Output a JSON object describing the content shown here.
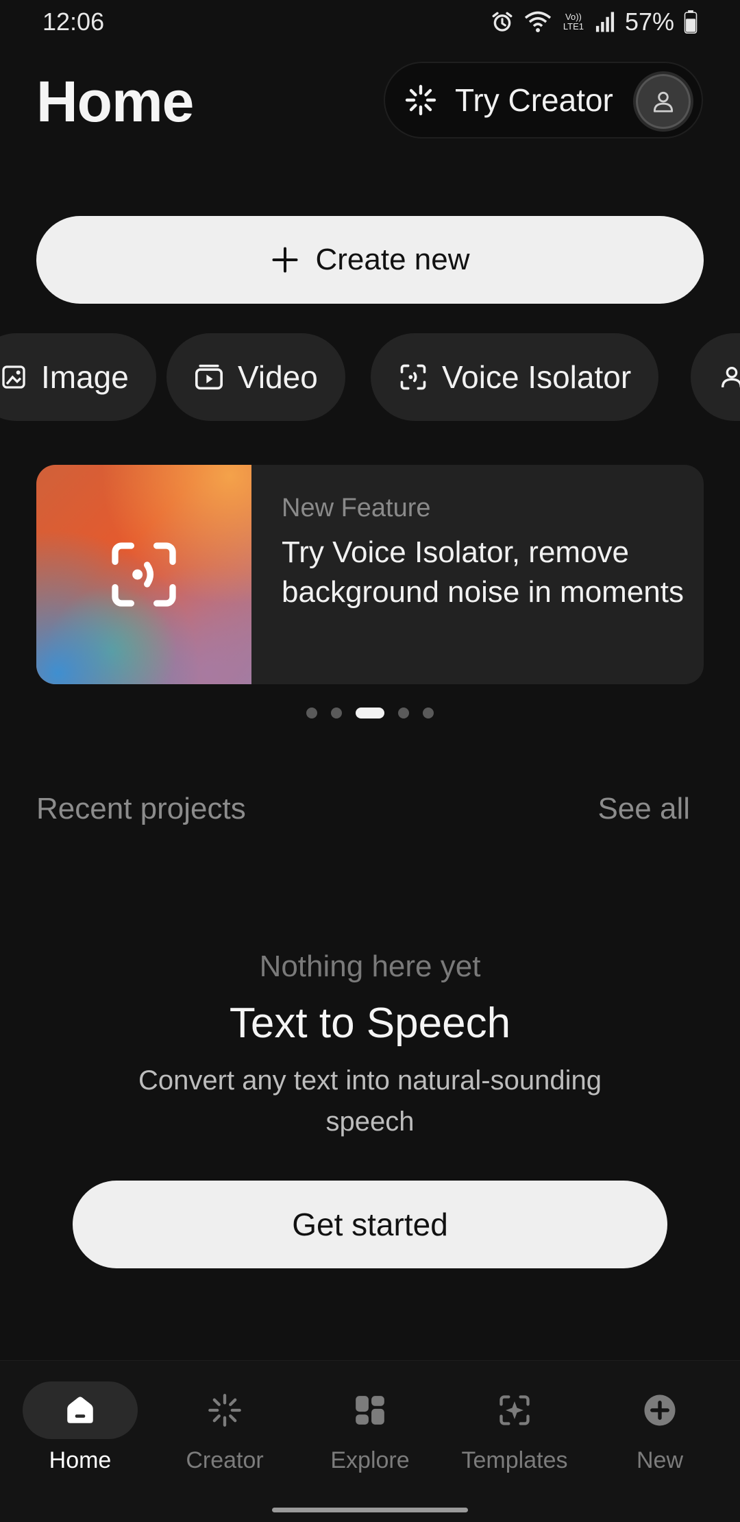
{
  "status_bar": {
    "time": "12:06",
    "network_label": "Vo)) LTE1",
    "battery": "57%"
  },
  "header": {
    "title": "Home",
    "try_creator_label": "Try Creator"
  },
  "create_new_label": "Create new",
  "chips": [
    {
      "label": "Image",
      "icon": "image-icon"
    },
    {
      "label": "Video",
      "icon": "video-icon"
    },
    {
      "label": "Voice Isolator",
      "icon": "voice-isolator-icon"
    },
    {
      "label": "",
      "icon": "person-icon"
    }
  ],
  "feature_card": {
    "eyebrow": "New Feature",
    "title": "Try Voice Isolator, remove background noise in moments",
    "pager": {
      "total": 5,
      "active": 3
    }
  },
  "recent": {
    "title": "Recent projects",
    "see_all": "See all"
  },
  "empty_state": {
    "eyebrow": "Nothing here yet",
    "title": "Text to Speech",
    "description": "Convert any text into natural-sounding speech",
    "cta": "Get started"
  },
  "bottom_nav": [
    {
      "label": "Home",
      "icon": "home-icon",
      "active": true
    },
    {
      "label": "Creator",
      "icon": "sparkle-icon",
      "active": false
    },
    {
      "label": "Explore",
      "icon": "grid-icon",
      "active": false
    },
    {
      "label": "Templates",
      "icon": "templates-icon",
      "active": false
    },
    {
      "label": "New",
      "icon": "plus-circle-icon",
      "active": false
    }
  ],
  "colors": {
    "background": "#111111",
    "surface": "#242424",
    "button_light": "#efefef",
    "muted_text": "#8c8c8c"
  }
}
